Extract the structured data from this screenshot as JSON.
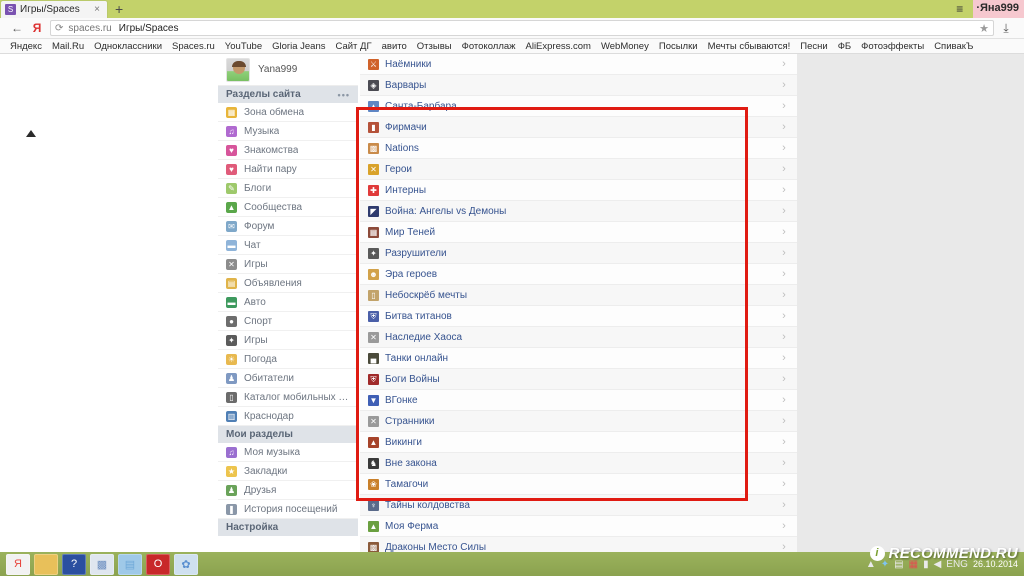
{
  "browser": {
    "tab": {
      "favicon": "S",
      "title": "Игры/Spaces",
      "close": "×"
    },
    "newtab_label": "+",
    "hamburger": "≡",
    "user_chip": "·Яна999",
    "back_icon": "←",
    "yandex_icon": "Я",
    "reload_icon": "⟳",
    "url_host": "spaces.ru",
    "url_title": "Игры/Spaces",
    "star_icon": "★",
    "download_icon": "⤓",
    "bookmarks": [
      "Яндекс",
      "Mail.Ru",
      "Одноклассники",
      "Spaces.ru",
      "YouTube",
      "Gloria Jeans",
      "Сайт ДГ",
      "авито",
      "Отзывы",
      "Фотоколлаж",
      "AliExpress.com",
      "WebMoney",
      "Посылки",
      "Мечты сбываются!",
      "Песни",
      "ФБ",
      "Фотоэффекты",
      "СпивакЪ"
    ]
  },
  "page": {
    "scroll_up_marker": "▲",
    "profile": {
      "username": "Yana999",
      "avatar": "user-avatar"
    },
    "sections": [
      {
        "header": "Разделы сайта",
        "header_dots": "•••",
        "items": [
          {
            "label": "Зона обмена",
            "icon": "exchange-icon",
            "color": "#e8b53a",
            "glyph": "▦"
          },
          {
            "label": "Музыка",
            "icon": "music-icon",
            "color": "#b06ad0",
            "glyph": "♫"
          },
          {
            "label": "Знакомства",
            "icon": "dating-icon",
            "color": "#d7559b",
            "glyph": "♥"
          },
          {
            "label": "Найти пару",
            "icon": "find-pair-icon",
            "color": "#e05b7a",
            "glyph": "♥"
          },
          {
            "label": "Блоги",
            "icon": "blogs-icon",
            "color": "#9ec96b",
            "glyph": "✎"
          },
          {
            "label": "Сообщества",
            "icon": "community-icon",
            "color": "#5aa74a",
            "glyph": "▲"
          },
          {
            "label": "Форум",
            "icon": "forum-icon",
            "color": "#7fa8c9",
            "glyph": "✉"
          },
          {
            "label": "Чат",
            "icon": "chat-icon",
            "color": "#8fb4d9",
            "glyph": "▬"
          },
          {
            "label": "Игры",
            "icon": "games-icon",
            "color": "#8c8c8c",
            "glyph": "✕"
          },
          {
            "label": "Объявления",
            "icon": "ads-icon",
            "color": "#e0b44a",
            "glyph": "▤"
          },
          {
            "label": "Авто",
            "icon": "auto-icon",
            "color": "#3e9a5e",
            "glyph": "▬"
          },
          {
            "label": "Спорт",
            "icon": "sport-icon",
            "color": "#6d6d6d",
            "glyph": "●"
          },
          {
            "label": "Игры",
            "icon": "games-icon-2",
            "color": "#5b5b5b",
            "glyph": "✦"
          },
          {
            "label": "Погода",
            "icon": "weather-icon",
            "color": "#e8b94f",
            "glyph": "☀"
          },
          {
            "label": "Обитатели",
            "icon": "residents-icon",
            "color": "#7f99c2",
            "glyph": "♟"
          },
          {
            "label": "Каталог мобильных …",
            "icon": "mobile-icon",
            "color": "#6b6b6b",
            "glyph": "▯"
          },
          {
            "label": "Краснодар",
            "icon": "city-icon",
            "color": "#4f7fb5",
            "glyph": "▥"
          }
        ]
      },
      {
        "header": "Мои разделы",
        "header_dots": "",
        "items": [
          {
            "label": "Моя музыка",
            "icon": "my-music-icon",
            "color": "#9a6fd0",
            "glyph": "♫"
          },
          {
            "label": "Закладки",
            "icon": "bookmarks-icon",
            "color": "#edc44d",
            "glyph": "★"
          },
          {
            "label": "Друзья",
            "icon": "friends-icon",
            "color": "#6aa35a",
            "glyph": "♟"
          },
          {
            "label": "История посещений",
            "icon": "history-icon",
            "color": "#8a97a8",
            "glyph": "❚"
          }
        ]
      },
      {
        "header": "Настройка",
        "header_dots": "",
        "items": []
      }
    ],
    "games": [
      {
        "label": "Наёмники",
        "icon": "mercenaries-icon",
        "color": "#d0622a",
        "glyph": "⚔",
        "in_box": true
      },
      {
        "label": "Варвары",
        "icon": "barbarians-icon",
        "color": "#4a4a52",
        "glyph": "◈",
        "in_box": true
      },
      {
        "label": "Санта-Барбара",
        "icon": "santa-barbara-icon",
        "color": "#5f86c4",
        "glyph": "▲",
        "in_box": true
      },
      {
        "label": "Фирмачи",
        "icon": "firmachi-icon",
        "color": "#b5523a",
        "glyph": "▮",
        "in_box": true
      },
      {
        "label": "Nations",
        "icon": "nations-icon",
        "color": "#c98b4a",
        "glyph": "▩",
        "in_box": true
      },
      {
        "label": "Герои",
        "icon": "heroes-icon",
        "color": "#d9a22a",
        "glyph": "✕",
        "in_box": true
      },
      {
        "label": "Интерны",
        "icon": "interns-icon",
        "color": "#e03a3a",
        "glyph": "✚",
        "in_box": true
      },
      {
        "label": "Война: Ангелы vs Демоны",
        "icon": "war-angels-icon",
        "color": "#2f3b6e",
        "glyph": "◤",
        "in_box": true
      },
      {
        "label": "Мир Теней",
        "icon": "shadow-world-icon",
        "color": "#8c4a3a",
        "glyph": "▦",
        "in_box": true
      },
      {
        "label": "Разрушители",
        "icon": "destroyers-icon",
        "color": "#5a5a5a",
        "glyph": "✦",
        "in_box": true
      },
      {
        "label": "Эра героев",
        "icon": "hero-era-icon",
        "color": "#d2a24a",
        "glyph": "☻",
        "in_box": true
      },
      {
        "label": "Небоскрёб мечты",
        "icon": "skyscraper-icon",
        "color": "#c2a36a",
        "glyph": "▯",
        "in_box": true
      },
      {
        "label": "Битва титанов",
        "icon": "titans-icon",
        "color": "#4a5fa8",
        "glyph": "⛨",
        "in_box": true
      },
      {
        "label": "Наследие Хаоса",
        "icon": "chaos-legacy-icon",
        "color": "#9a9a9a",
        "glyph": "✕",
        "in_box": true
      },
      {
        "label": "Танки онлайн",
        "icon": "tanks-icon",
        "color": "#4a4a3a",
        "glyph": "▄",
        "in_box": true
      },
      {
        "label": "Боги Войны",
        "icon": "war-gods-icon",
        "color": "#a02a2a",
        "glyph": "⛨",
        "in_box": true
      },
      {
        "label": "ВГонке",
        "icon": "vgonke-icon",
        "color": "#3f5fb5",
        "glyph": "▼",
        "in_box": true
      },
      {
        "label": "Странники",
        "icon": "wanderers-icon",
        "color": "#9a9a9a",
        "glyph": "✕",
        "in_box": true
      },
      {
        "label": "Викинги",
        "icon": "vikings-icon",
        "color": "#a6432a",
        "glyph": "▲",
        "in_box": true
      },
      {
        "label": "Вне закона",
        "icon": "outlaw-icon",
        "color": "#3a3a3a",
        "glyph": "♞",
        "in_box": false
      },
      {
        "label": "Тамагочи",
        "icon": "tamagotchi-icon",
        "color": "#c9802a",
        "glyph": "❀",
        "in_box": false
      },
      {
        "label": "Тайны колдовства",
        "icon": "witchcraft-icon",
        "color": "#5a6a8a",
        "glyph": "♆",
        "in_box": false
      },
      {
        "label": "Моя Ферма",
        "icon": "my-farm-icon",
        "color": "#6aa040",
        "glyph": "▲",
        "in_box": false
      },
      {
        "label": "Драконы Место Силы",
        "icon": "dragons-icon",
        "color": "#8a5a3a",
        "glyph": "▩",
        "in_box": false
      }
    ],
    "row_chevron": "›",
    "highlight_color": "#e01b12"
  },
  "taskbar": {
    "buttons": [
      {
        "name": "yandex-browser-taskbar-button",
        "glyph": "Я",
        "color": "#e8453c",
        "bg": "#f2f2f2"
      },
      {
        "name": "file-explorer-taskbar-button",
        "glyph": "▤",
        "color": "#e8c05a",
        "bg": "#e8c05a"
      },
      {
        "name": "help-taskbar-button",
        "glyph": "?",
        "color": "#ffffff",
        "bg": "#2b4fa0"
      },
      {
        "name": "contacts-taskbar-button",
        "glyph": "▩",
        "color": "#6d8fc0",
        "bg": "#dfe6ef"
      },
      {
        "name": "notepad-taskbar-button",
        "glyph": "▤",
        "color": "#6ea8d8",
        "bg": "#9fc9e8"
      },
      {
        "name": "opera-taskbar-button",
        "glyph": "O",
        "color": "#ffffff",
        "bg": "#c8282a"
      },
      {
        "name": "paint-taskbar-button",
        "glyph": "✿",
        "color": "#5a8fd0",
        "bg": "#cfe0ef"
      }
    ],
    "tray": {
      "expand": "▲",
      "bluetooth": "✦",
      "devices": "▤",
      "antivirus": "▦",
      "network": "▮",
      "volume": "◀",
      "language": "ENG",
      "date": "26.10.2014"
    }
  },
  "watermark": {
    "badge": "i",
    "text": "RECOMMEND.RU"
  }
}
